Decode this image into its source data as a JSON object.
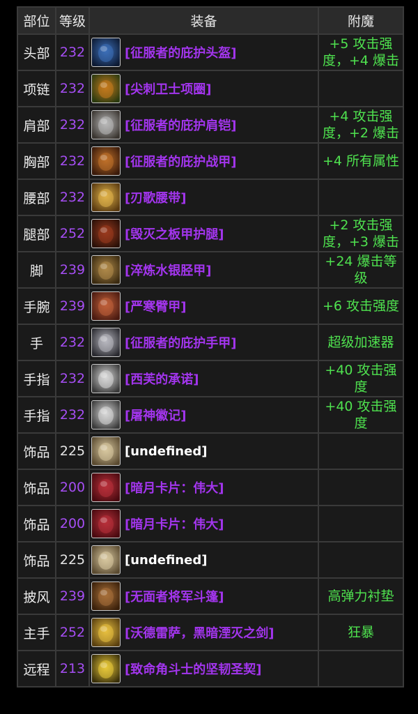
{
  "colors": {
    "epic": "#a335ee",
    "common": "#ffffff",
    "enchant": "#4fe24f",
    "ilvl_epic": "#a64ef4",
    "ilvl_common": "#e6e6e6"
  },
  "headers": {
    "slot": "部位",
    "ilvl": "等级",
    "item": "装备",
    "enchant": "附魔"
  },
  "rows": [
    {
      "slot": "头部",
      "ilvl": "232",
      "item": "[征服者的庇护头盔]",
      "enchant": "+5 攻击强度，+4 爆击",
      "quality": "epic",
      "icon": "helm-icon",
      "c1": "#3d6fb8",
      "c2": "#0d1a33"
    },
    {
      "slot": "项链",
      "ilvl": "232",
      "item": "[尖刺卫士项圈]",
      "enchant": "",
      "quality": "epic",
      "icon": "necklace-icon",
      "c1": "#c47a1e",
      "c2": "#2b3a0f"
    },
    {
      "slot": "肩部",
      "ilvl": "232",
      "item": "[征服者的庇护肩铠]",
      "enchant": "+4 攻击强度，+2 爆击",
      "quality": "epic",
      "icon": "shoulder-icon",
      "c1": "#b9b9b9",
      "c2": "#3a3530"
    },
    {
      "slot": "胸部",
      "ilvl": "232",
      "item": "[征服者的庇护战甲]",
      "enchant": "+4 所有属性",
      "quality": "epic",
      "icon": "chest-icon",
      "c1": "#c0712a",
      "c2": "#3a1a0a"
    },
    {
      "slot": "腰部",
      "ilvl": "232",
      "item": "[刃歌腰带]",
      "enchant": "",
      "quality": "epic",
      "icon": "belt-icon",
      "c1": "#e0b34a",
      "c2": "#5a3a10"
    },
    {
      "slot": "腿部",
      "ilvl": "252",
      "item": "[毁灭之板甲护腿]",
      "enchant": "+2 攻击强度，+3 爆击",
      "quality": "epic",
      "icon": "legs-icon",
      "c1": "#9a3a1e",
      "c2": "#2a1008"
    },
    {
      "slot": "脚",
      "ilvl": "239",
      "item": "[淬炼水银胫甲]",
      "enchant": "+24 爆击等级",
      "quality": "epic",
      "icon": "boots-icon",
      "c1": "#b08a4a",
      "c2": "#3a2a10"
    },
    {
      "slot": "手腕",
      "ilvl": "239",
      "item": "[严寒臂甲]",
      "enchant": "+6 攻击强度",
      "quality": "epic",
      "icon": "bracer-icon",
      "c1": "#c0603a",
      "c2": "#4a1a10"
    },
    {
      "slot": "手",
      "ilvl": "232",
      "item": "[征服者的庇护手甲]",
      "enchant": "超级加速器",
      "quality": "epic",
      "icon": "gauntlet-icon",
      "c1": "#b8b8c0",
      "c2": "#2a2a30"
    },
    {
      "slot": "手指",
      "ilvl": "232",
      "item": "[西芙的承诺]",
      "enchant": "+40 攻击强度",
      "quality": "epic",
      "icon": "ring-icon",
      "c1": "#d8d8d8",
      "c2": "#3a3a3a"
    },
    {
      "slot": "手指",
      "ilvl": "232",
      "item": "[屠神徽记]",
      "enchant": "+40 攻击强度",
      "quality": "epic",
      "icon": "ring-icon",
      "c1": "#d8d8d8",
      "c2": "#3a3a3a"
    },
    {
      "slot": "饰品",
      "ilvl": "225",
      "item": "[undefined]",
      "enchant": "",
      "quality": "common",
      "icon": "trinket-icon",
      "c1": "#d8c8a0",
      "c2": "#5a4a30"
    },
    {
      "slot": "饰品",
      "ilvl": "200",
      "item": "[暗月卡片：伟大]",
      "enchant": "",
      "quality": "epic",
      "icon": "card-icon",
      "c1": "#b8303a",
      "c2": "#4a0a10"
    },
    {
      "slot": "饰品",
      "ilvl": "200",
      "item": "[暗月卡片：伟大]",
      "enchant": "",
      "quality": "epic",
      "icon": "card-icon",
      "c1": "#b8303a",
      "c2": "#4a0a10"
    },
    {
      "slot": "饰品",
      "ilvl": "225",
      "item": "[undefined]",
      "enchant": "",
      "quality": "common",
      "icon": "trinket-icon",
      "c1": "#d8c8a0",
      "c2": "#5a4a30"
    },
    {
      "slot": "披风",
      "ilvl": "239",
      "item": "[无面者将军斗篷]",
      "enchant": "高弹力衬垫",
      "quality": "epic",
      "icon": "cloak-icon",
      "c1": "#a8703a",
      "c2": "#3a200a"
    },
    {
      "slot": "主手",
      "ilvl": "252",
      "item": "[沃德雷萨，黑暗湮灭之剑]",
      "enchant": "狂暴",
      "quality": "epic",
      "icon": "sword-icon",
      "c1": "#e8c040",
      "c2": "#5a4010"
    },
    {
      "slot": "远程",
      "ilvl": "213",
      "item": "[致命角斗士的坚韧圣契]",
      "enchant": "",
      "quality": "epic",
      "icon": "libram-icon",
      "c1": "#e8c83a",
      "c2": "#3a300a"
    }
  ]
}
